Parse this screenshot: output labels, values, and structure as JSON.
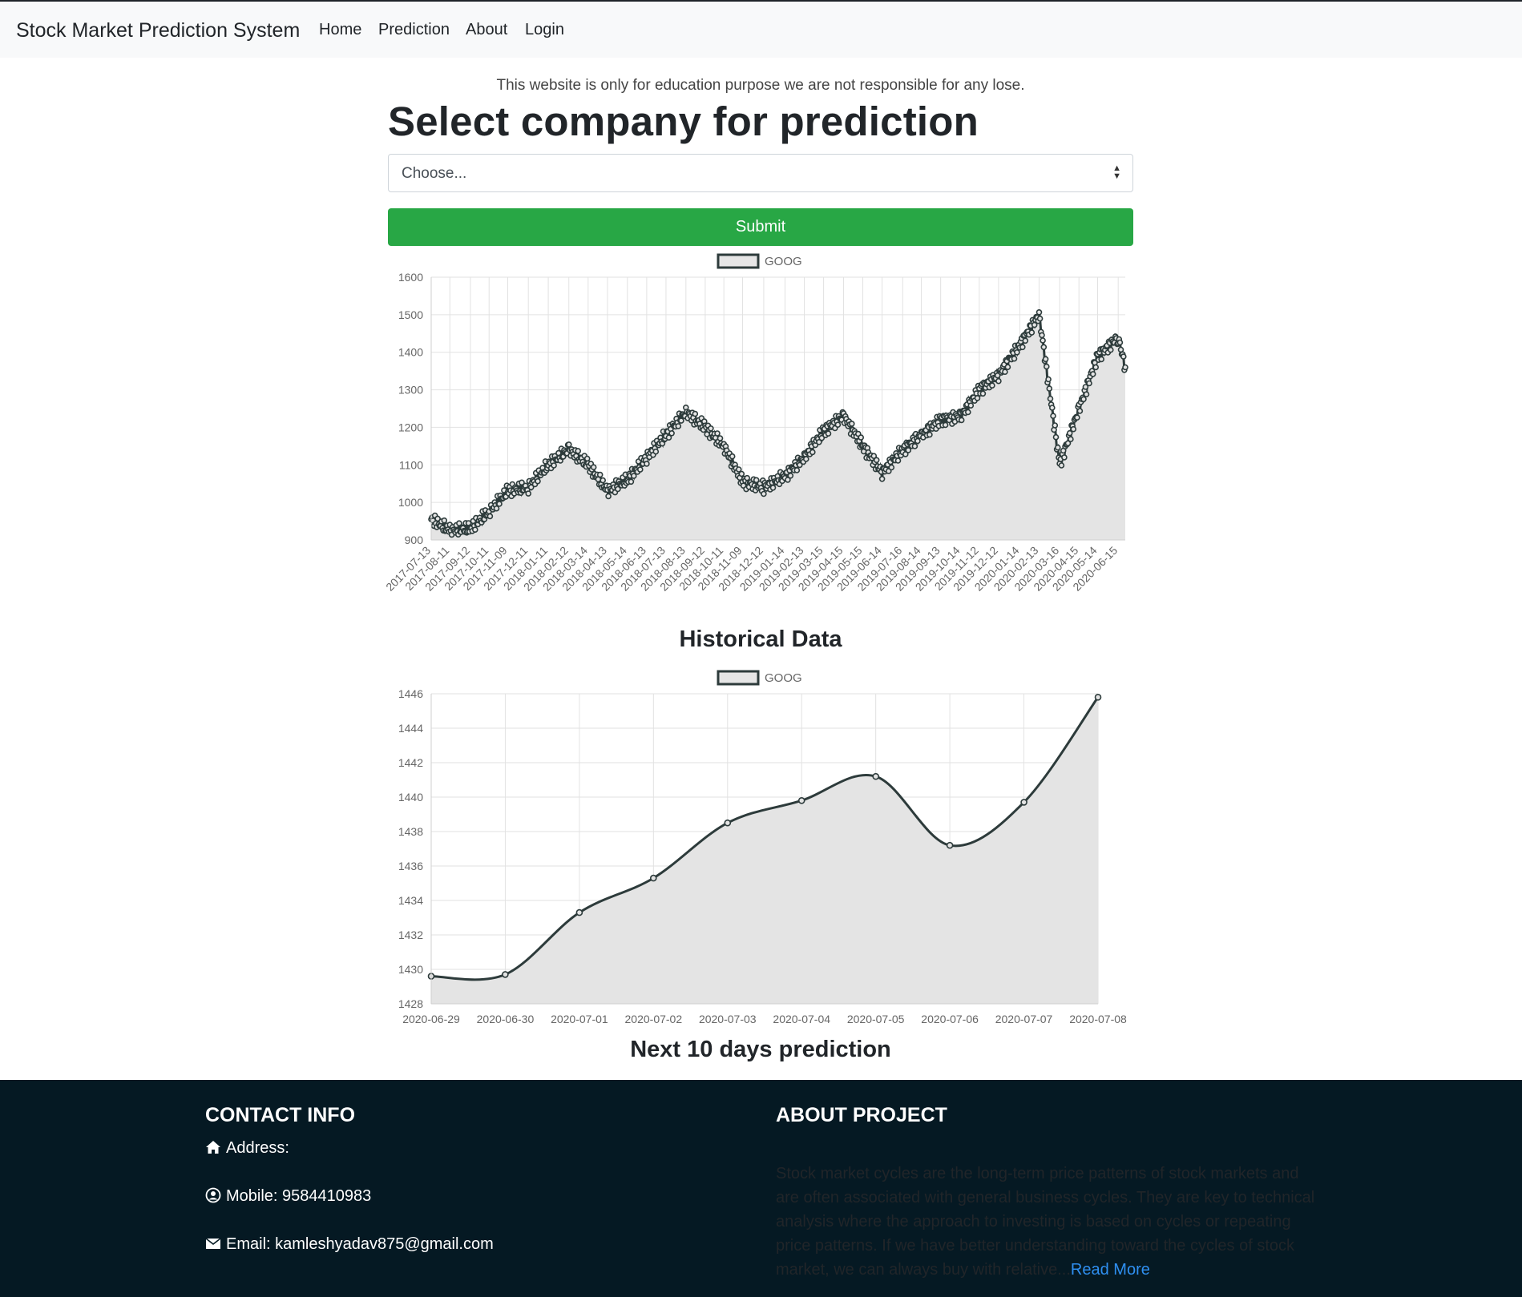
{
  "navbar": {
    "brand": "Stock Market Prediction System",
    "links": [
      "Home",
      "Prediction",
      "About",
      "Login"
    ]
  },
  "disclaimer": "This website is only for education purpose we are not responsible for any lose.",
  "heading": "Select company for prediction",
  "company_select": {
    "selected": "Choose..."
  },
  "submit_label": "Submit",
  "colors": {
    "accent": "#28a745",
    "footer_bg": "#051923",
    "line": "#2d3b3b",
    "link": "#2f8ff0"
  },
  "chart_data": [
    {
      "type": "line",
      "title": "Historical Data",
      "legend": "GOOG",
      "legend_position": "top",
      "grid": true,
      "filled": true,
      "xlabel": "",
      "ylabel": "",
      "ylim": [
        900,
        1600
      ],
      "y_ticks": [
        900,
        1000,
        1100,
        1200,
        1300,
        1400,
        1500,
        1600
      ],
      "x_ticks": [
        "2017-07-13",
        "2017-08-11",
        "2017-09-12",
        "2017-10-11",
        "2017-11-09",
        "2017-12-11",
        "2018-01-11",
        "2018-02-12",
        "2018-03-14",
        "2018-04-13",
        "2018-05-14",
        "2018-06-13",
        "2018-07-13",
        "2018-08-13",
        "2018-09-12",
        "2018-10-11",
        "2018-11-09",
        "2018-12-12",
        "2019-01-14",
        "2019-02-13",
        "2019-03-15",
        "2019-04-15",
        "2019-05-15",
        "2019-06-14",
        "2019-07-16",
        "2019-08-14",
        "2019-09-13",
        "2019-10-14",
        "2019-11-12",
        "2019-12-12",
        "2020-01-14",
        "2020-02-13",
        "2020-03-16",
        "2020-04-15",
        "2020-05-14",
        "2020-06-15"
      ],
      "series": [
        {
          "name": "GOOG",
          "x": [
            "2017-07-13",
            "2017-08-11",
            "2017-09-12",
            "2017-10-11",
            "2017-11-09",
            "2017-12-11",
            "2018-01-11",
            "2018-02-12",
            "2018-03-14",
            "2018-04-13",
            "2018-05-14",
            "2018-06-13",
            "2018-07-13",
            "2018-08-13",
            "2018-09-12",
            "2018-10-11",
            "2018-11-09",
            "2018-12-12",
            "2019-01-14",
            "2019-02-13",
            "2019-03-15",
            "2019-04-15",
            "2019-05-15",
            "2019-06-14",
            "2019-07-16",
            "2019-08-14",
            "2019-09-13",
            "2019-10-14",
            "2019-11-12",
            "2019-12-12",
            "2020-01-14",
            "2020-02-13",
            "2020-03-16",
            "2020-04-15",
            "2020-05-14",
            "2020-06-15",
            "2020-06-26"
          ],
          "values": [
            955,
            925,
            930,
            975,
            1030,
            1040,
            1100,
            1140,
            1100,
            1030,
            1060,
            1120,
            1180,
            1240,
            1200,
            1150,
            1055,
            1040,
            1070,
            1120,
            1190,
            1230,
            1150,
            1080,
            1140,
            1180,
            1220,
            1230,
            1300,
            1340,
            1420,
            1500,
            1100,
            1250,
            1390,
            1440,
            1360
          ]
        }
      ]
    },
    {
      "type": "line",
      "title": "Next 10 days prediction",
      "legend": "GOOG",
      "legend_position": "top",
      "grid": true,
      "filled": true,
      "xlabel": "",
      "ylabel": "",
      "ylim": [
        1428,
        1446
      ],
      "y_ticks": [
        1428,
        1430,
        1432,
        1434,
        1436,
        1438,
        1440,
        1442,
        1444,
        1446
      ],
      "categories": [
        "2020-06-29",
        "2020-06-30",
        "2020-07-01",
        "2020-07-02",
        "2020-07-03",
        "2020-07-04",
        "2020-07-05",
        "2020-07-06",
        "2020-07-07",
        "2020-07-08"
      ],
      "series": [
        {
          "name": "GOOG",
          "values": [
            1429.6,
            1429.7,
            1433.3,
            1435.3,
            1438.5,
            1439.8,
            1441.2,
            1437.2,
            1439.7,
            1445.8
          ]
        }
      ]
    }
  ],
  "footer": {
    "contact_heading": "CONTACT INFO",
    "address_label": "Address:",
    "mobile_label": "Mobile: 9584410983",
    "email_label": "Email: kamleshyadav875@gmail.com",
    "about_heading": "ABOUT PROJECT",
    "about_text": "Stock market cycles are the long-term price patterns of stock markets and are often associated with general business cycles. They are key to technical analysis where the approach to investing is based on cycles or repeating price patterns. If we have better understanding toward the cycles of stock market, we can always buy with relative...",
    "read_more": "Read More",
    "icons": [
      "home-icon",
      "user-circle-icon",
      "envelope-icon"
    ]
  }
}
